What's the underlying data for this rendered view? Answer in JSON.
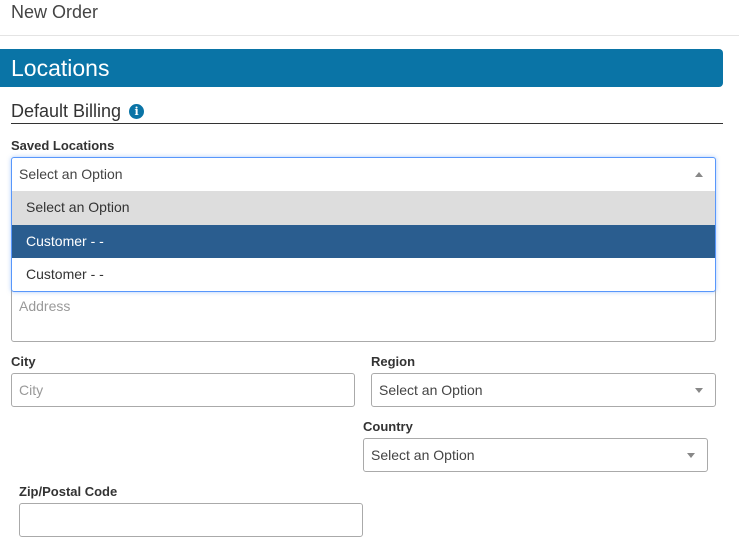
{
  "page": {
    "title": "New Order"
  },
  "section": {
    "title": "Locations"
  },
  "billing": {
    "title": "Default Billing",
    "info_icon": "info-icon",
    "saved_locations": {
      "label": "Saved Locations",
      "value": "Select an Option",
      "options": [
        "Select an Option",
        "Customer - -",
        "Customer - -"
      ]
    },
    "address": {
      "placeholder": "Address"
    },
    "city": {
      "label": "City",
      "placeholder": "City"
    },
    "region": {
      "label": "Region",
      "value": "Select an Option"
    },
    "country": {
      "label": "Country",
      "value": "Select an Option"
    },
    "zip": {
      "label": "Zip/Postal Code"
    }
  },
  "colors": {
    "accent": "#0a74a6",
    "highlight": "#2a5d8f"
  }
}
